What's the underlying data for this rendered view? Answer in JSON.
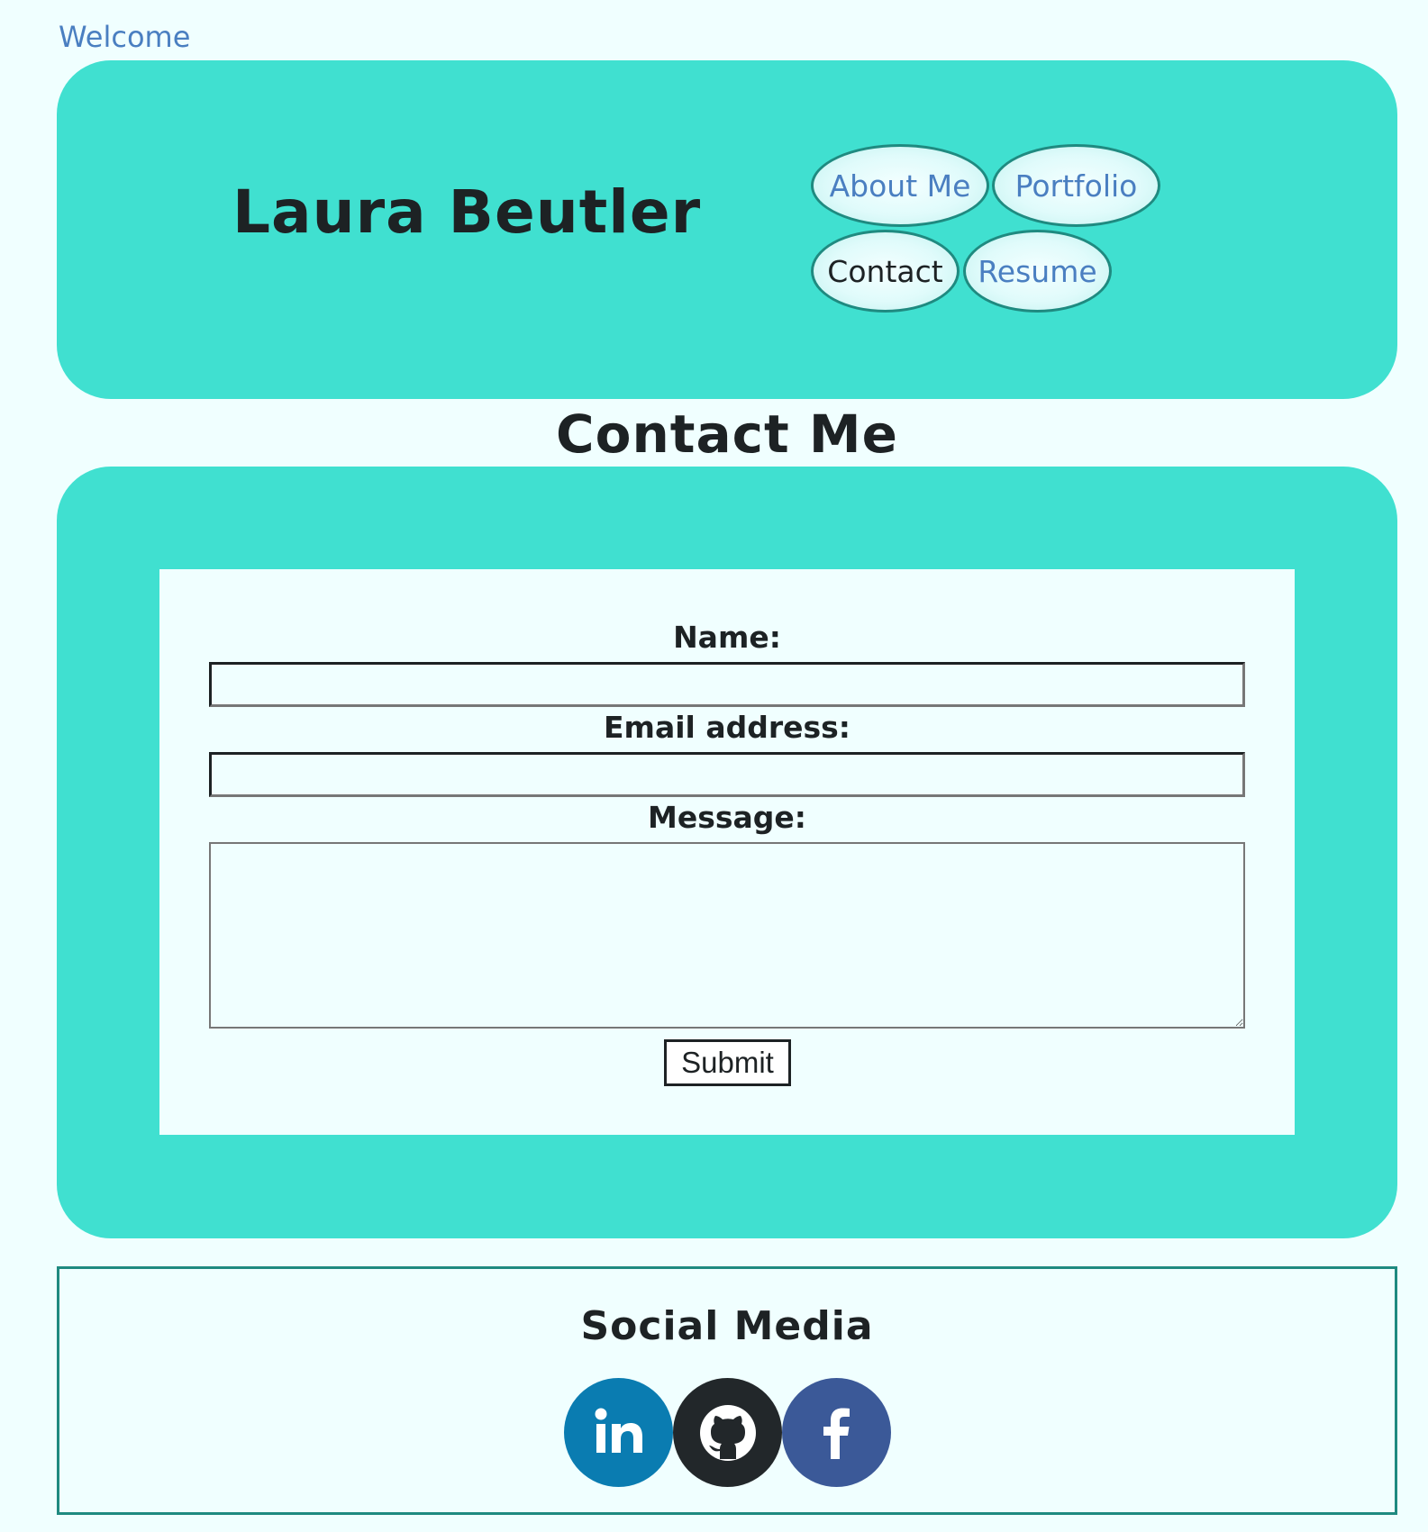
{
  "header": {
    "welcome_link": "Welcome",
    "site_name": "Laura Beutler",
    "nav": {
      "about": "About Me",
      "portfolio": "Portfolio",
      "contact": "Contact",
      "resume": "Resume"
    },
    "active_nav": "contact"
  },
  "contact": {
    "title": "Contact Me",
    "name_label": "Name:",
    "name_value": "",
    "email_label": "Email address:",
    "email_value": "",
    "message_label": "Message:",
    "message_value": "",
    "submit_label": "Submit"
  },
  "social": {
    "title": "Social Media",
    "icons": [
      "linkedin-icon",
      "github-icon",
      "facebook-icon"
    ]
  },
  "colors": {
    "page_background": "#f0ffff",
    "panel_turquoise": "#40e0d0",
    "link_blue": "#4a7fc1",
    "nav_border": "#1f8a80",
    "linkedin_blue": "#0a7cb1",
    "github_dark": "#22272a",
    "facebook_blue": "#3b5998"
  }
}
